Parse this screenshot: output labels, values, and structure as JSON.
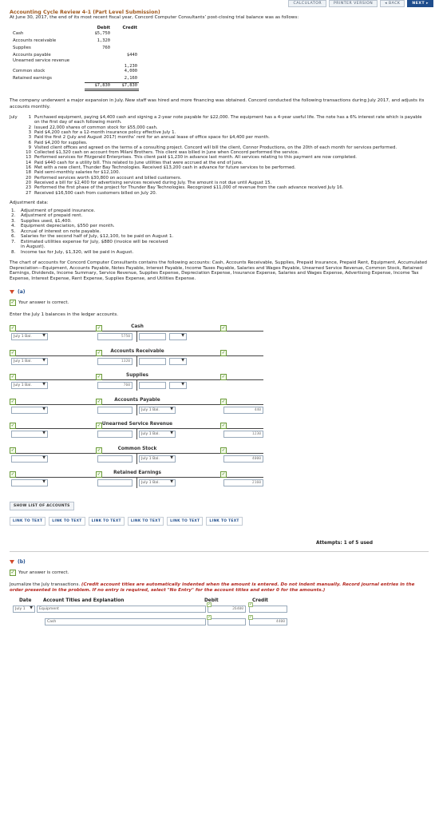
{
  "nav": {
    "calculator": "CALCULATOR",
    "printer": "PRINTER VERSION",
    "back": "◂ BACK",
    "next": "NEXT ▸"
  },
  "title": "Accounting Cycle Review 4-1 (Part Level Submission)",
  "intro": "At June 30, 2017, the end of its most recent fiscal year, Concord Computer Consultants’ post-closing trial balance was as follows:",
  "trial_balance": {
    "debit_label": "Debit",
    "credit_label": "Credit",
    "rows": [
      {
        "account": "Cash",
        "debit": "$5,750",
        "credit": ""
      },
      {
        "account": "Accounts receivable",
        "debit": "1,320",
        "credit": ""
      },
      {
        "account": "Supplies",
        "debit": "760",
        "credit": ""
      },
      {
        "account": "Accounts payable",
        "debit": "",
        "credit": "$440"
      },
      {
        "account": "Unearned service revenue",
        "debit": "",
        "credit": "1,230"
      },
      {
        "account": "Common stock",
        "debit": "",
        "credit": "4,000"
      },
      {
        "account": "Retained earnings",
        "debit": "",
        "credit": "2,160"
      }
    ],
    "total_debit": "$7,830",
    "total_credit": "$7,830"
  },
  "narrative": "The company underwent a major expansion in July. New staff was hired and more financing was obtained. Concord conducted the following transactions during July 2017, and adjusts its accounts monthly.",
  "transactions": [
    {
      "m": "July",
      "d": "1",
      "t": "Purchased equipment, paying $4,400 cash and signing a 2-year note payable for $22,000. The equipment has a 4-year useful life. The note has a 6% interest rate which is payable on the first day of each following month."
    },
    {
      "m": "",
      "d": "2",
      "t": "Issued 22,000 shares of common stock for $55,000 cash."
    },
    {
      "m": "",
      "d": "3",
      "t": "Paid $4,200 cash for a 12-month insurance policy effective July 1."
    },
    {
      "m": "",
      "d": "3",
      "t": "Paid the first 2 (July and August 2017) months’ rent for an annual lease of office space for $4,400 per month."
    },
    {
      "m": "",
      "d": "6",
      "t": "Paid $4,200 for supplies."
    },
    {
      "m": "",
      "d": "9",
      "t": "Visited client offices and agreed on the terms of a consulting project. Concord will bill the client, Connor Productions, on the 20th of each month for services performed."
    },
    {
      "m": "",
      "d": "10",
      "t": "Collected $1,320 cash on account from Milani Brothers. This client was billed in June when Concord performed the service."
    },
    {
      "m": "",
      "d": "13",
      "t": "Performed services for Fitzgerald Enterprises. This client paid $1,230 in advance last month. All services relating to this payment are now completed."
    },
    {
      "m": "",
      "d": "14",
      "t": "Paid $440 cash for a utility bill. This related to June utilities that were accrued at the end of June."
    },
    {
      "m": "",
      "d": "16",
      "t": "Met with a new client, Thunder Bay Technologies. Received $13,200 cash in advance for future services to be performed."
    },
    {
      "m": "",
      "d": "18",
      "t": "Paid semi-monthly salaries for $12,100."
    },
    {
      "m": "",
      "d": "20",
      "t": "Performed services worth $30,800 on account and billed customers."
    },
    {
      "m": "",
      "d": "20",
      "t": "Received a bill for $2,400 for advertising services received during July. The amount is not due until August 15."
    },
    {
      "m": "",
      "d": "23",
      "t": "Performed the first phase of the project for Thunder Bay Technologies. Recognized $11,000 of revenue from the cash advance received July 16."
    },
    {
      "m": "",
      "d": "27",
      "t": "Received $16,500 cash from customers billed on July 20."
    }
  ],
  "adjustment": {
    "header": "Adjustment data:",
    "items": [
      {
        "n": "1.",
        "t": "Adjustment of prepaid insurance."
      },
      {
        "n": "2.",
        "t": "Adjustment of prepaid rent."
      },
      {
        "n": "3.",
        "t": "Supplies used, $1,400."
      },
      {
        "n": "4.",
        "t": "Equipment depreciation, $550 per month."
      },
      {
        "n": "5.",
        "t": "Accrual of interest on note payable."
      },
      {
        "n": "6.",
        "t": "Salaries for the second half of July, $12,100, to be paid on August 1."
      },
      {
        "n": "7.",
        "t": "Estimated utilities expense for July, $880 (invoice will be received in August)."
      },
      {
        "n": "8.",
        "t": "Income tax for July, $1,320, will be paid in August."
      }
    ]
  },
  "chart_of_accounts": "The chart of accounts for Concord Computer Consultants contains the following accounts: Cash, Accounts Receivable, Supplies, Prepaid Insurance, Prepaid Rent, Equipment, Accumulated Depreciation—Equipment, Accounts Payable, Notes Payable, Interest Payable, Income Taxes Payable, Salaries and Wages Payable, Unearned Service Revenue, Common Stock, Retained Earnings, Dividends, Income Summary, Service Revenue, Supplies Expense, Depreciation Expense, Insurance Expense, Salaries and Wages Expense, Advertising Expense, Income Tax Expense, Interest Expense, Rent Expense, Supplies Expense, and Utilities Expense.",
  "part_a": {
    "label": "(a)",
    "correct": "Your answer is correct.",
    "prompt": "Enter the July 1 balances in the ledger accounts.",
    "ledgers": [
      {
        "name": "Cash",
        "side": "debit",
        "date": "July 1 Bal.",
        "amount": "5750"
      },
      {
        "name": "Accounts Receivable",
        "side": "debit",
        "date": "July 1 Bal.",
        "amount": "1320"
      },
      {
        "name": "Supplies",
        "side": "debit",
        "date": "July 1 Bal.",
        "amount": "760"
      },
      {
        "name": "Accounts Payable",
        "side": "credit",
        "date": "July 1 Bal.",
        "amount": "440"
      },
      {
        "name": "Unearned Service Revenue",
        "side": "credit",
        "date": "July 1 Bal.",
        "amount": "1230"
      },
      {
        "name": "Common Stock",
        "side": "credit",
        "date": "July 1 Bal.",
        "amount": "4000"
      },
      {
        "name": "Retained Earnings",
        "side": "credit",
        "date": "July 1 Bal.",
        "amount": "2160"
      }
    ],
    "show_list": "SHOW LIST OF ACCOUNTS",
    "links": [
      "LINK TO TEXT",
      "LINK TO TEXT",
      "LINK TO TEXT",
      "LINK TO TEXT",
      "LINK TO TEXT",
      "LINK TO TEXT"
    ],
    "attempts": "Attempts: 1 of 5 used"
  },
  "part_b": {
    "label": "(b)",
    "correct": "Your answer is correct.",
    "instr_plain": "Journalize the July transactions. ",
    "instr_em": "(Credit account titles are automatically indented when the amount is entered. Do not indent manually. Record journal entries in the order presented in the problem. If no entry is required, select \"No Entry\" for the account titles and enter 0 for the amounts.)",
    "headers": {
      "date": "Date",
      "account": "Account Titles and Explanation",
      "debit": "Debit",
      "credit": "Credit"
    },
    "entries": [
      {
        "date": "July 1",
        "account": "Equipment",
        "debit": "26400",
        "credit": ""
      },
      {
        "date": "",
        "account": "Cash",
        "debit": "",
        "credit": "4400"
      }
    ]
  }
}
